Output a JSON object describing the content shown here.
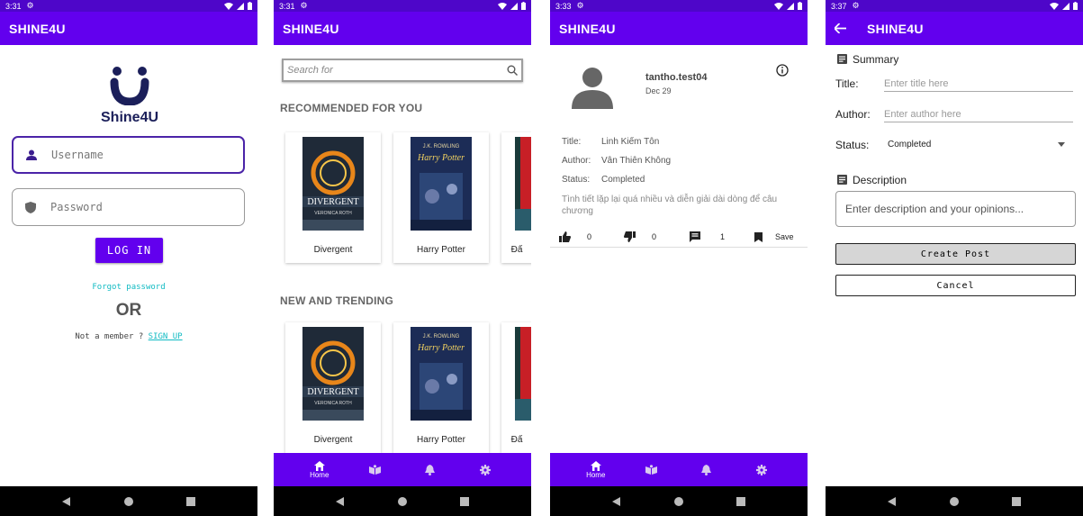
{
  "screens": {
    "login": {
      "time": "3:31",
      "app_title": "SHINE4U",
      "logo_text": "Shine4U",
      "username_placeholder": "Username",
      "password_placeholder": "Password",
      "login_label": "LOG IN",
      "forgot_label": "Forgot password",
      "or_label": "OR",
      "not_member_text": "Not a member ?",
      "signup_label": "SIGN UP"
    },
    "home": {
      "time": "3:31",
      "app_title": "SHINE4U",
      "search_placeholder": "Search for",
      "recommended_title": "RECOMMENDED FOR YOU",
      "trending_title": "NEW AND TRENDING",
      "books": [
        {
          "title": "Divergent",
          "cover_author": "VERONICA ROTH",
          "cover_title": "DIVERGENT"
        },
        {
          "title": "Harry Potter",
          "cover_author": "J.K. ROWLING",
          "cover_title": "Harry Potter"
        },
        {
          "title": "Đấ"
        }
      ],
      "nav": {
        "home": "Home"
      }
    },
    "post": {
      "time": "3:33",
      "app_title": "SHINE4U",
      "username": "tantho.test04",
      "date": "Dec 29",
      "title_key": "Title:",
      "title_val": "Linh Kiếm Tôn",
      "author_key": "Author:",
      "author_val": "Vân Thiên Không",
      "status_key": "Status:",
      "status_val": "Completed",
      "body": "Tình tiết lặp lại quá nhiều và diễn giải dài dòng để câu chương",
      "likes": "0",
      "dislikes": "0",
      "comments": "1",
      "save_label": "Save",
      "nav": {
        "home": "Home"
      }
    },
    "create": {
      "time": "3:37",
      "app_title": "SHINE4U",
      "summary_label": "Summary",
      "title_label": "Title:",
      "title_placeholder": "Enter title here",
      "author_label": "Author:",
      "author_placeholder": "Enter author here",
      "status_label": "Status:",
      "status_value": "Completed",
      "description_label": "Description",
      "description_placeholder": "Enter description and your opinions...",
      "create_label": "Create Post",
      "cancel_label": "Cancel"
    }
  },
  "colors": {
    "primary": "#6200ee",
    "status_bar": "#4e06c9",
    "link": "#11bbc3",
    "logo": "#1b1f5a"
  }
}
